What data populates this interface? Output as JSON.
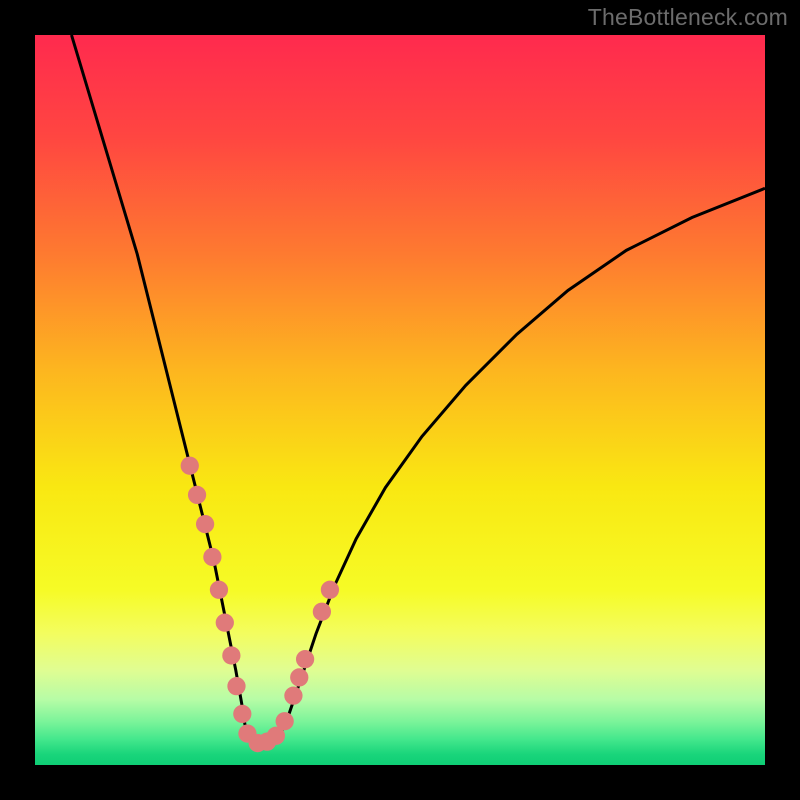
{
  "watermark": {
    "text": "TheBottleneck.com"
  },
  "chart_data": {
    "type": "line",
    "title": "",
    "xlabel": "",
    "ylabel": "",
    "xlim": [
      0,
      100
    ],
    "ylim": [
      0,
      100
    ],
    "background_gradient_stops": [
      {
        "offset": 0,
        "color": "#FF2A4E"
      },
      {
        "offset": 0.14,
        "color": "#FF4641"
      },
      {
        "offset": 0.3,
        "color": "#FE7A30"
      },
      {
        "offset": 0.46,
        "color": "#FDB61F"
      },
      {
        "offset": 0.62,
        "color": "#F9E812"
      },
      {
        "offset": 0.76,
        "color": "#F6FB26"
      },
      {
        "offset": 0.82,
        "color": "#F3FD5F"
      },
      {
        "offset": 0.87,
        "color": "#E0FD92"
      },
      {
        "offset": 0.91,
        "color": "#B7FCA6"
      },
      {
        "offset": 0.94,
        "color": "#7CF49A"
      },
      {
        "offset": 0.965,
        "color": "#43E78C"
      },
      {
        "offset": 0.985,
        "color": "#1AD57B"
      },
      {
        "offset": 1.0,
        "color": "#0FCE75"
      }
    ],
    "series": [
      {
        "name": "bottleneck-curve",
        "x": [
          5,
          8,
          11,
          14,
          16,
          18,
          20,
          21.5,
          23,
          24.5,
          25.5,
          26.5,
          27.5,
          28.3,
          29,
          30.5,
          32,
          33.5,
          34.8,
          36.5,
          38.5,
          41,
          44,
          48,
          53,
          59,
          66,
          73,
          81,
          90,
          100
        ],
        "y": [
          100,
          90,
          80,
          70,
          62,
          54,
          46,
          40,
          34,
          28,
          23,
          18,
          13,
          8.5,
          4,
          3,
          3.2,
          4,
          7,
          12,
          18,
          24.5,
          31,
          38,
          45,
          52,
          59,
          65,
          70.5,
          75,
          79
        ]
      }
    ],
    "dots": {
      "name": "highlight-dots",
      "x": [
        21.2,
        22.2,
        23.3,
        24.3,
        25.2,
        26.0,
        26.9,
        27.6,
        28.4,
        29.1,
        30.5,
        31.8,
        33.0,
        34.2,
        35.4,
        36.2,
        37.0,
        39.3,
        40.4
      ],
      "y": [
        41.0,
        37.0,
        33.0,
        28.5,
        24.0,
        19.5,
        15.0,
        10.8,
        7.0,
        4.3,
        3.0,
        3.2,
        4.0,
        6.0,
        9.5,
        12.0,
        14.5,
        21.0,
        24.0
      ]
    }
  }
}
